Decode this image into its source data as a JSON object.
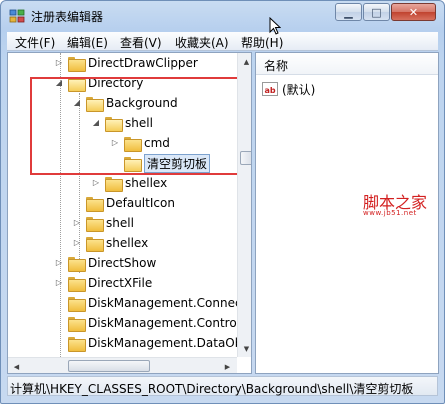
{
  "window": {
    "title": "注册表编辑器",
    "minimize_glyph": "▁",
    "maximize_glyph": "□",
    "close_glyph": "✕"
  },
  "menu": [
    {
      "label": "文件(F)"
    },
    {
      "label": "编辑(E)"
    },
    {
      "label": "查看(V)"
    },
    {
      "label": "收藏夹(A)"
    },
    {
      "label": "帮助(H)"
    }
  ],
  "tree": [
    {
      "label": "DirectDrawClipper",
      "expander": "▷"
    },
    {
      "label": "Directory",
      "expander": "◢"
    },
    {
      "label": "Background",
      "expander": "◢"
    },
    {
      "label": "shell",
      "expander": "◢"
    },
    {
      "label": "cmd",
      "expander": "▷"
    },
    {
      "label": "清空剪切板",
      "expander": "",
      "selected": true
    },
    {
      "label": "shellex",
      "expander": "▷"
    },
    {
      "label": "DefaultIcon",
      "expander": ""
    },
    {
      "label": "shell",
      "expander": "▷"
    },
    {
      "label": "shellex",
      "expander": "▷"
    },
    {
      "label": "DirectShow",
      "expander": "▷"
    },
    {
      "label": "DirectXFile",
      "expander": "▷"
    },
    {
      "label": "DiskManagement.Connec",
      "expander": ""
    },
    {
      "label": "DiskManagement.Contro",
      "expander": ""
    },
    {
      "label": "DiskManagement.DataOb",
      "expander": ""
    }
  ],
  "list": {
    "column_name": "名称",
    "rows": [
      {
        "icon": "string-value-icon",
        "name": "(默认)"
      }
    ]
  },
  "watermark": {
    "text": "脚本之家",
    "url": "www.jb51.net"
  },
  "status": {
    "path": "计算机\\HKEY_CLASSES_ROOT\\Directory\\Background\\shell\\清空剪切板"
  },
  "colors": {
    "highlight_box": "#e03b3b",
    "selection_bg": "#dbe8f8",
    "folder": "#f0bd3e"
  }
}
